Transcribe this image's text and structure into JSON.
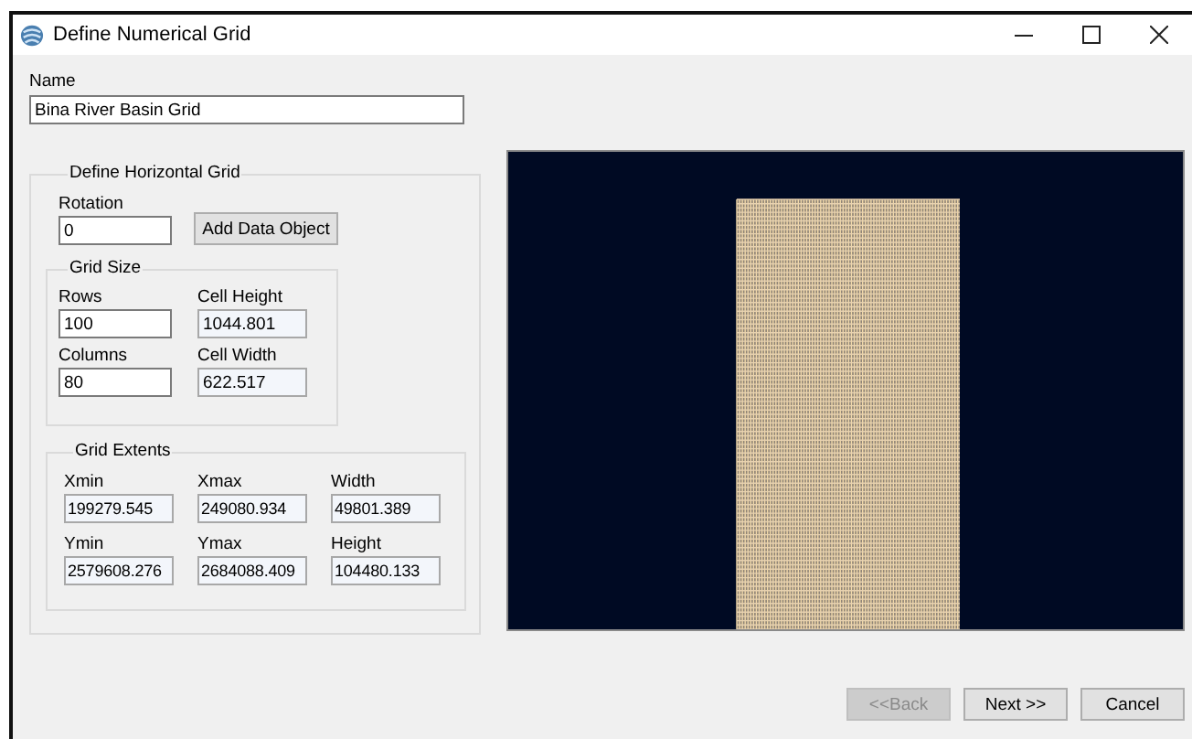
{
  "window": {
    "title": "Define Numerical Grid"
  },
  "name": {
    "label": "Name",
    "value": "Bina River Basin Grid"
  },
  "horizontal_grid": {
    "title": "Define Horizontal Grid",
    "rotation": {
      "label": "Rotation",
      "value": "0",
      "readonly": false
    },
    "add_button": {
      "label": "Add Data Object",
      "disabled": false
    },
    "grid_size": {
      "title": "Grid Size",
      "fields": [
        {
          "label": "Rows",
          "value": "100",
          "readonly": false
        },
        {
          "label": "Cell Height",
          "value": "1044.801",
          "readonly": true
        },
        {
          "label": "Columns",
          "value": "80",
          "readonly": false
        },
        {
          "label": "Cell Width",
          "value": "622.517",
          "readonly": true
        }
      ]
    },
    "grid_extents": {
      "title": "Grid Extents",
      "fields": [
        {
          "label": "Xmin",
          "value": "199279.545",
          "readonly": true
        },
        {
          "label": "Xmax",
          "value": "249080.934",
          "readonly": true
        },
        {
          "label": "Width",
          "value": "49801.389",
          "readonly": true
        },
        {
          "label": "Ymin",
          "value": "2579608.276",
          "readonly": true
        },
        {
          "label": "Ymax",
          "value": "2684088.409",
          "readonly": true
        },
        {
          "label": "Height",
          "value": "104480.133",
          "readonly": true
        }
      ]
    }
  },
  "buttons": [
    {
      "label": "<<Back",
      "disabled": true
    },
    {
      "label": "Next >>",
      "disabled": false
    },
    {
      "label": "Cancel",
      "disabled": false
    }
  ]
}
